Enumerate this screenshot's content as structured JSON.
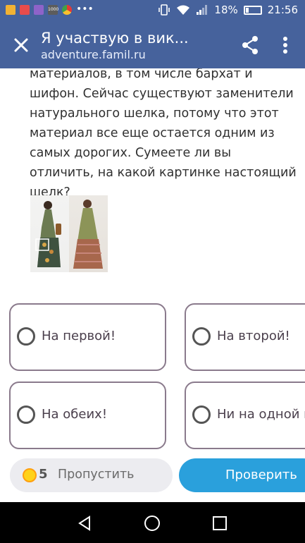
{
  "status_bar": {
    "battery_percent": "18%",
    "time": "21:56",
    "notification_icons": [
      "app-icon",
      "mail-icon",
      "gallery-icon",
      "news-icon",
      "chrome-icon",
      "more-dots-icon"
    ],
    "system_icons": [
      "vibrate-icon",
      "wifi-icon",
      "signal-icon",
      "battery-icon"
    ]
  },
  "app_bar": {
    "title": "Я участвую в вик...",
    "url": "adventure.famil.ru",
    "color": "#46629c"
  },
  "question": {
    "text": "материалов, в том числе бархат и шифон. Сейчас существуют заменители натурального шелка, потому что этот материал все еще остается одним из самых дорогих. Сумеете ли вы отличить, на какой картинке настоящий шелк?"
  },
  "answers": [
    {
      "label": "На первой!"
    },
    {
      "label": "На второй!"
    },
    {
      "label": "На обеих!"
    },
    {
      "label": "Ни на одной и"
    }
  ],
  "footer": {
    "coin_count": "5",
    "skip_label": "Пропустить",
    "check_label": "Проверить",
    "check_color": "#2aa0dc"
  }
}
